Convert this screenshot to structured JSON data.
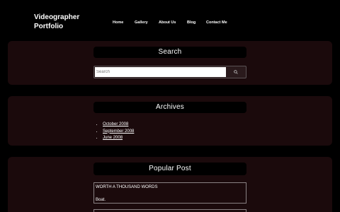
{
  "header": {
    "site_title": "Videographer Portfolio",
    "nav": [
      {
        "label": "Home"
      },
      {
        "label": "Gallery"
      },
      {
        "label": "About Us"
      },
      {
        "label": "Blog"
      },
      {
        "label": "Contact Me"
      }
    ]
  },
  "search_widget": {
    "title": "Search",
    "placeholder": "Search",
    "button_icon": "search-icon"
  },
  "archives_widget": {
    "title": "Archives",
    "items": [
      {
        "label": "October 2008"
      },
      {
        "label": "September 2008"
      },
      {
        "label": "June 2008"
      }
    ]
  },
  "popular_widget": {
    "title": "Popular Post",
    "post": {
      "title": "WORTH A THOUSAND WORDS",
      "excerpt": "Boat."
    }
  },
  "colors": {
    "background": "#000000",
    "panel": "#1b0a0c",
    "text": "#ffffff"
  }
}
